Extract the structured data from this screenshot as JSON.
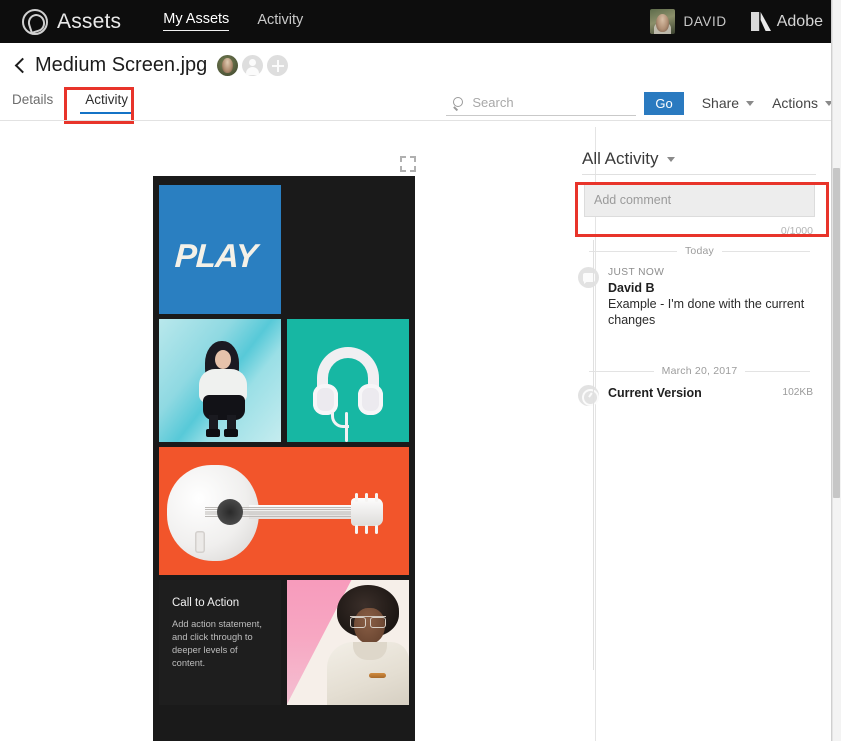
{
  "topbar": {
    "logo_icon": "creative-cloud-icon",
    "brand": "Assets",
    "nav": [
      {
        "label": "My Assets",
        "active": true
      },
      {
        "label": "Activity",
        "active": false
      }
    ],
    "user": {
      "name": "DAVID",
      "avatar_icon": "user-avatar-photo"
    },
    "adobe": {
      "mark_icon": "adobe-logo-icon",
      "label": "Adobe"
    },
    "bg_color": "#0d0d0d"
  },
  "asset_header": {
    "back_icon": "back-chevron-icon",
    "title": "Medium Screen.jpg",
    "collaborators": [
      {
        "icon": "collaborator-avatar-photo"
      },
      {
        "icon": "collaborator-avatar-placeholder"
      }
    ],
    "add_collaborator_icon": "add-person-icon"
  },
  "tabs": [
    {
      "label": "Details",
      "active": false
    },
    {
      "label": "Activity",
      "active": true
    }
  ],
  "toolbar": {
    "search": {
      "icon": "search-icon",
      "placeholder": "Search",
      "value": ""
    },
    "go_label": "Go",
    "share_label": "Share",
    "actions_label": "Actions",
    "caret_icon": "chevron-down-icon",
    "go_color": "#2a7ac0"
  },
  "preview": {
    "expand_icon": "fullscreen-expand-icon",
    "tiles": {
      "play": {
        "text": "PLAY",
        "bg": "#2a7fc1"
      },
      "woman": {
        "alt": "woman-crouching-photo",
        "bg": "#8fd9e2"
      },
      "headphones": {
        "alt": "white-headphones-photo",
        "bg": "#17b7a3"
      },
      "guitar": {
        "alt": "white-acoustic-guitar-photo",
        "bg": "#f2552b"
      },
      "cta": {
        "title": "Call to Action",
        "body": "Add action statement, and click through to deeper levels of content.",
        "bg": "#1e1e1e"
      },
      "man": {
        "alt": "man-with-afro-photo",
        "bg": "#f79bbc"
      }
    },
    "canvas_bg": "#1a1a1a"
  },
  "activity": {
    "filter_label": "All Activity",
    "filter_caret_icon": "chevron-down-icon",
    "comment": {
      "placeholder": "Add comment",
      "value": "",
      "char_count": "0/1000"
    },
    "highlight_color": "#e8342a",
    "groups": [
      {
        "separator": "Today",
        "entries": [
          {
            "icon": "comment-bubble-icon",
            "when": "JUST NOW",
            "who": "David B",
            "message": "Example - I'm done with the current changes",
            "size": ""
          }
        ]
      },
      {
        "separator": "March 20, 2017",
        "entries": [
          {
            "icon": "clock-icon",
            "when": "",
            "who": "Current Version",
            "message": "",
            "size": "102KB"
          }
        ]
      }
    ]
  },
  "scrollbar": {
    "name": "vertical-scrollbar"
  }
}
